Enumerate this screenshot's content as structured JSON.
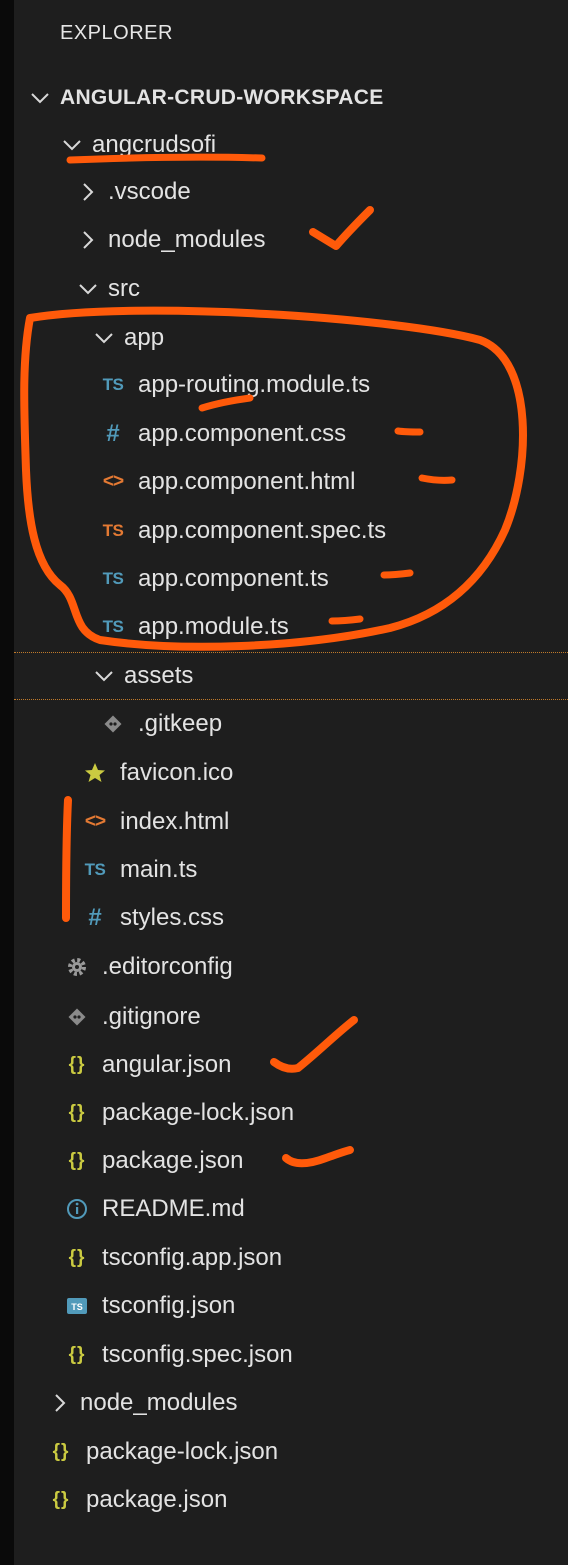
{
  "explorer": {
    "title": "EXPLORER",
    "workspace": "ANGULAR-CRUD-WORKSPACE"
  },
  "tree": [
    {
      "label": "angcrudsofi",
      "kind": "folder-open"
    },
    {
      "label": ".vscode",
      "kind": "folder-closed"
    },
    {
      "label": "node_modules",
      "kind": "folder-closed"
    },
    {
      "label": "src",
      "kind": "folder-open"
    },
    {
      "label": "app",
      "kind": "folder-open"
    },
    {
      "label": "app-routing.module.ts",
      "kind": "ts"
    },
    {
      "label": "app.component.css",
      "kind": "css"
    },
    {
      "label": "app.component.html",
      "kind": "html"
    },
    {
      "label": "app.component.spec.ts",
      "kind": "ts-spec"
    },
    {
      "label": "app.component.ts",
      "kind": "ts"
    },
    {
      "label": "app.module.ts",
      "kind": "ts"
    },
    {
      "label": "assets",
      "kind": "folder-open"
    },
    {
      "label": ".gitkeep",
      "kind": "git"
    },
    {
      "label": "favicon.ico",
      "kind": "star"
    },
    {
      "label": "index.html",
      "kind": "html"
    },
    {
      "label": "main.ts",
      "kind": "ts"
    },
    {
      "label": "styles.css",
      "kind": "css"
    },
    {
      "label": ".editorconfig",
      "kind": "gear"
    },
    {
      "label": ".gitignore",
      "kind": "git"
    },
    {
      "label": "angular.json",
      "kind": "json"
    },
    {
      "label": "package-lock.json",
      "kind": "json"
    },
    {
      "label": "package.json",
      "kind": "json"
    },
    {
      "label": "README.md",
      "kind": "info"
    },
    {
      "label": "tsconfig.app.json",
      "kind": "json"
    },
    {
      "label": "tsconfig.json",
      "kind": "tsconfig"
    },
    {
      "label": "tsconfig.spec.json",
      "kind": "json"
    },
    {
      "label": "node_modules",
      "kind": "folder-closed"
    },
    {
      "label": "package-lock.json",
      "kind": "json"
    },
    {
      "label": "package.json",
      "kind": "json"
    }
  ],
  "icons": {
    "ts": "TS",
    "css": "#",
    "html": "<>",
    "json": "{}"
  },
  "colors": {
    "background": "#1e1e1e",
    "ts_blue": "#519aba",
    "html_orange": "#e37933",
    "json_yellow": "#cbcb41",
    "annotation_orange": "#ff5a0a",
    "icon_gray": "#9a9a9a"
  }
}
